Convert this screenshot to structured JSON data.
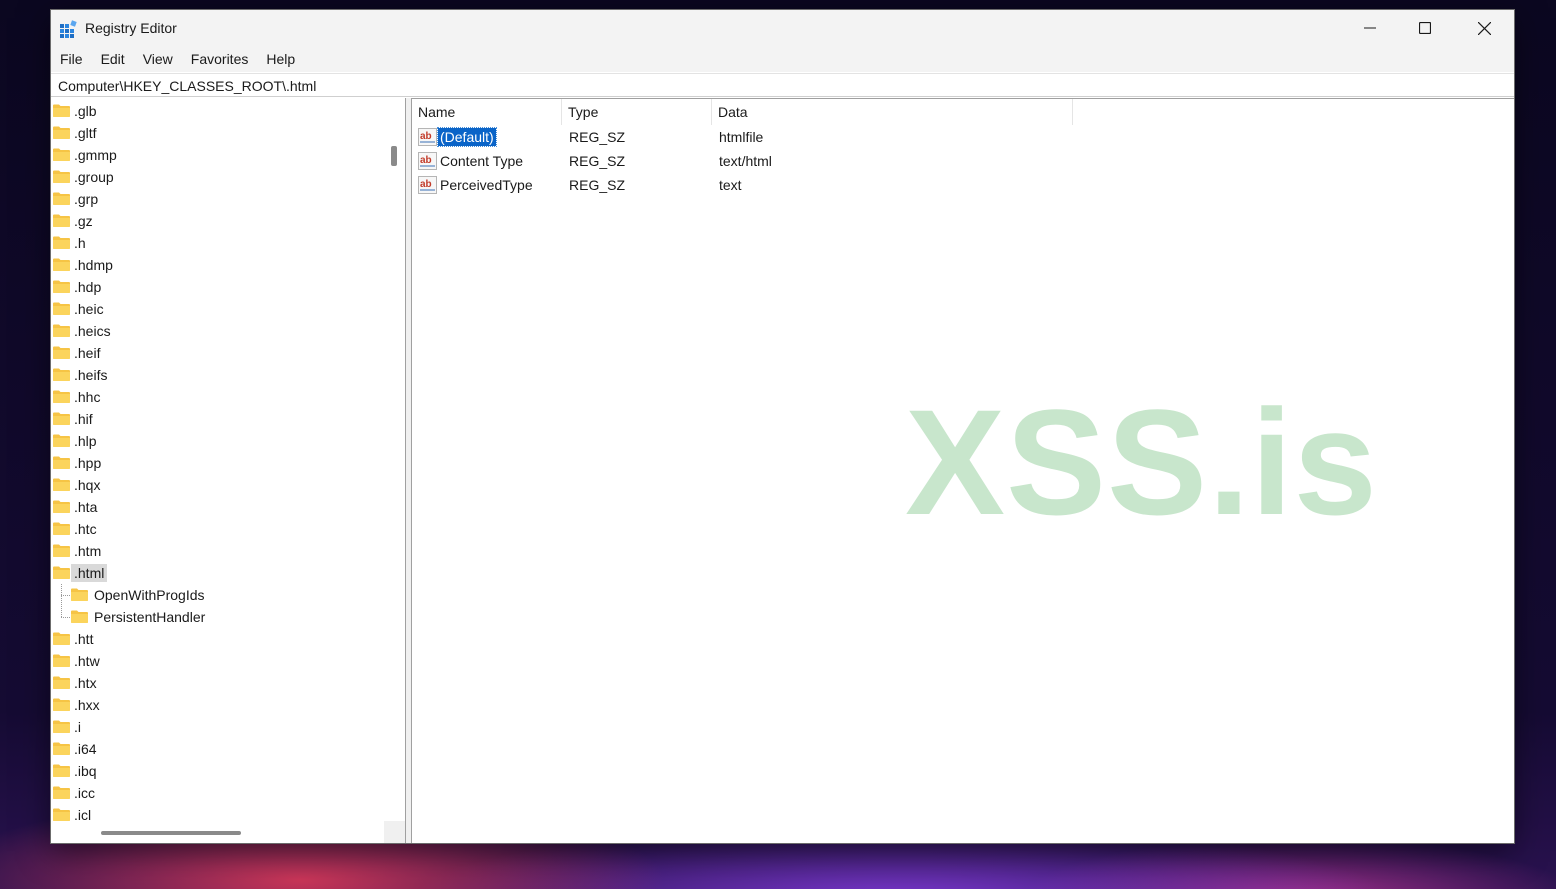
{
  "window": {
    "title": "Registry Editor"
  },
  "menu": [
    "File",
    "Edit",
    "View",
    "Favorites",
    "Help"
  ],
  "address": "Computer\\HKEY_CLASSES_ROOT\\.html",
  "tree": {
    "items": [
      {
        "label": ".glb",
        "level": 0
      },
      {
        "label": ".gltf",
        "level": 0
      },
      {
        "label": ".gmmp",
        "level": 0
      },
      {
        "label": ".group",
        "level": 0
      },
      {
        "label": ".grp",
        "level": 0
      },
      {
        "label": ".gz",
        "level": 0
      },
      {
        "label": ".h",
        "level": 0
      },
      {
        "label": ".hdmp",
        "level": 0
      },
      {
        "label": ".hdp",
        "level": 0
      },
      {
        "label": ".heic",
        "level": 0
      },
      {
        "label": ".heics",
        "level": 0
      },
      {
        "label": ".heif",
        "level": 0
      },
      {
        "label": ".heifs",
        "level": 0
      },
      {
        "label": ".hhc",
        "level": 0
      },
      {
        "label": ".hif",
        "level": 0
      },
      {
        "label": ".hlp",
        "level": 0
      },
      {
        "label": ".hpp",
        "level": 0
      },
      {
        "label": ".hqx",
        "level": 0
      },
      {
        "label": ".hta",
        "level": 0
      },
      {
        "label": ".htc",
        "level": 0
      },
      {
        "label": ".htm",
        "level": 0
      },
      {
        "label": ".html",
        "level": 0,
        "selected": true
      },
      {
        "label": "OpenWithProgIds",
        "level": 1
      },
      {
        "label": "PersistentHandler",
        "level": 1
      },
      {
        "label": ".htt",
        "level": 0
      },
      {
        "label": ".htw",
        "level": 0
      },
      {
        "label": ".htx",
        "level": 0
      },
      {
        "label": ".hxx",
        "level": 0
      },
      {
        "label": ".i",
        "level": 0
      },
      {
        "label": ".i64",
        "level": 0
      },
      {
        "label": ".ibq",
        "level": 0
      },
      {
        "label": ".icc",
        "level": 0
      },
      {
        "label": ".icl",
        "level": 0
      }
    ]
  },
  "values": {
    "headers": {
      "name": "Name",
      "type": "Type",
      "data": "Data"
    },
    "rows": [
      {
        "name": "(Default)",
        "type": "REG_SZ",
        "data": "htmlfile",
        "selected": true
      },
      {
        "name": "Content Type",
        "type": "REG_SZ",
        "data": "text/html"
      },
      {
        "name": "PerceivedType",
        "type": "REG_SZ",
        "data": "text"
      }
    ]
  },
  "watermark": "XSS.is",
  "colors": {
    "selection": "#0a64c8",
    "folder": "#f6c445",
    "watermark": "#c8e6cc"
  }
}
